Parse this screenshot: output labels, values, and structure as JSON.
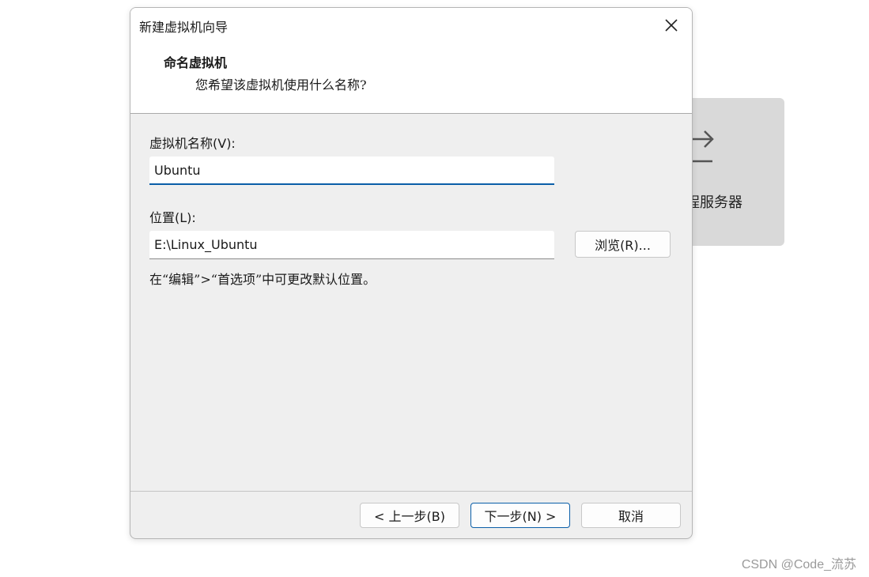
{
  "background_card": {
    "label": "程服务器",
    "icon": "upload-arrow-icon"
  },
  "dialog": {
    "title": "新建虚拟机向导",
    "section_title": "命名虚拟机",
    "section_subtitle": "您希望该虚拟机使用什么名称?",
    "name_label": "虚拟机名称(V):",
    "name_value": "Ubuntu",
    "location_label": "位置(L):",
    "location_value": "E:\\Linux_Ubuntu",
    "browse_label": "浏览(R)...",
    "hint": "在“编辑”>“首选项”中可更改默认位置。",
    "buttons": {
      "back": "< 上一步(B)",
      "next": "下一步(N) >",
      "cancel": "取消"
    }
  },
  "watermark": "CSDN @Code_流苏",
  "colors": {
    "accent": "#0a5ea8",
    "dialog_body": "#efefef",
    "background_card": "#d9d9d9"
  }
}
